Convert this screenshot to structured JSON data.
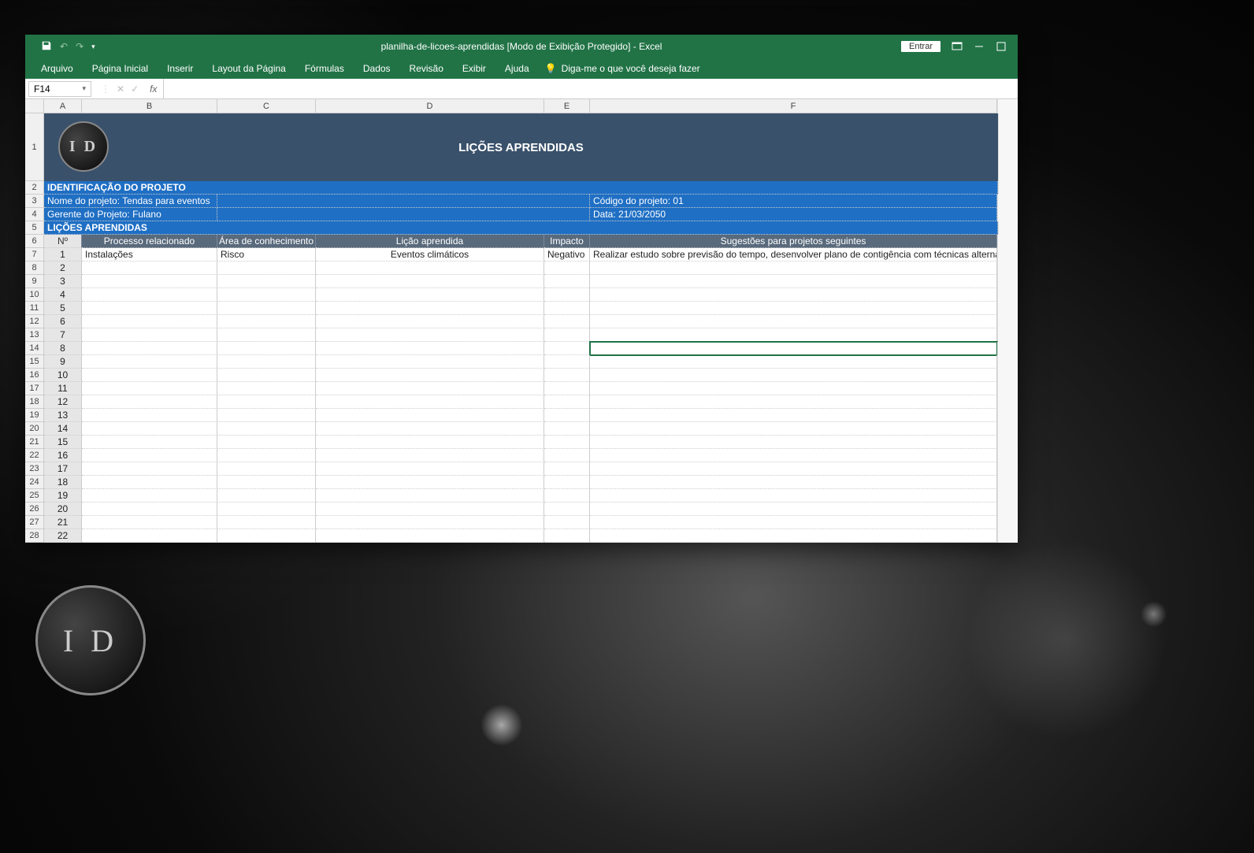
{
  "title": "planilha-de-licoes-aprendidas  [Modo de Exibição Protegido]  -  Excel",
  "signin": "Entrar",
  "tabs": [
    "Arquivo",
    "Página Inicial",
    "Inserir",
    "Layout da Página",
    "Fórmulas",
    "Dados",
    "Revisão",
    "Exibir",
    "Ajuda"
  ],
  "tellme": "Diga-me o que você deseja fazer",
  "namebox": "F14",
  "watermark": "I D",
  "columns": [
    "A",
    "B",
    "C",
    "D",
    "E",
    "F"
  ],
  "sheet": {
    "title": "LIÇÕES APRENDIDAS",
    "section1": "IDENTIFICAÇÃO DO PROJETO",
    "proj_name": "Nome do projeto:  Tendas para eventos",
    "proj_code": "Código do projeto: 01",
    "manager": "Gerente do Projeto:  Fulano",
    "date": "Data: 21/03/2050",
    "section2": "LIÇÕES APRENDIDAS",
    "headers": {
      "num": "Nº",
      "process": "Processo relacionado",
      "area": "Área de conhecimento",
      "lesson": "Lição aprendida",
      "impact": "Impacto",
      "suggest": "Sugestões para projetos seguintes"
    },
    "rows": [
      {
        "n": "1",
        "process": "Instalações",
        "area": "Risco",
        "lesson": "Eventos climáticos",
        "impact": "Negativo",
        "suggest": "Realizar estudo sobre previsão do tempo, desenvolver plano de contigência com técnicas alternativas"
      },
      {
        "n": "2",
        "process": "",
        "area": "",
        "lesson": "",
        "impact": "",
        "suggest": ""
      },
      {
        "n": "3",
        "process": "",
        "area": "",
        "lesson": "",
        "impact": "",
        "suggest": ""
      },
      {
        "n": "4",
        "process": "",
        "area": "",
        "lesson": "",
        "impact": "",
        "suggest": ""
      },
      {
        "n": "5",
        "process": "",
        "area": "",
        "lesson": "",
        "impact": "",
        "suggest": ""
      },
      {
        "n": "6",
        "process": "",
        "area": "",
        "lesson": "",
        "impact": "",
        "suggest": ""
      },
      {
        "n": "7",
        "process": "",
        "area": "",
        "lesson": "",
        "impact": "",
        "suggest": ""
      },
      {
        "n": "8",
        "process": "",
        "area": "",
        "lesson": "",
        "impact": "",
        "suggest": ""
      },
      {
        "n": "9",
        "process": "",
        "area": "",
        "lesson": "",
        "impact": "",
        "suggest": ""
      },
      {
        "n": "10",
        "process": "",
        "area": "",
        "lesson": "",
        "impact": "",
        "suggest": ""
      },
      {
        "n": "11",
        "process": "",
        "area": "",
        "lesson": "",
        "impact": "",
        "suggest": ""
      },
      {
        "n": "12",
        "process": "",
        "area": "",
        "lesson": "",
        "impact": "",
        "suggest": ""
      },
      {
        "n": "13",
        "process": "",
        "area": "",
        "lesson": "",
        "impact": "",
        "suggest": ""
      },
      {
        "n": "14",
        "process": "",
        "area": "",
        "lesson": "",
        "impact": "",
        "suggest": ""
      },
      {
        "n": "15",
        "process": "",
        "area": "",
        "lesson": "",
        "impact": "",
        "suggest": ""
      },
      {
        "n": "16",
        "process": "",
        "area": "",
        "lesson": "",
        "impact": "",
        "suggest": ""
      },
      {
        "n": "17",
        "process": "",
        "area": "",
        "lesson": "",
        "impact": "",
        "suggest": ""
      },
      {
        "n": "18",
        "process": "",
        "area": "",
        "lesson": "",
        "impact": "",
        "suggest": ""
      },
      {
        "n": "19",
        "process": "",
        "area": "",
        "lesson": "",
        "impact": "",
        "suggest": ""
      },
      {
        "n": "20",
        "process": "",
        "area": "",
        "lesson": "",
        "impact": "",
        "suggest": ""
      },
      {
        "n": "21",
        "process": "",
        "area": "",
        "lesson": "",
        "impact": "",
        "suggest": ""
      },
      {
        "n": "22",
        "process": "",
        "area": "",
        "lesson": "",
        "impact": "",
        "suggest": ""
      }
    ]
  }
}
